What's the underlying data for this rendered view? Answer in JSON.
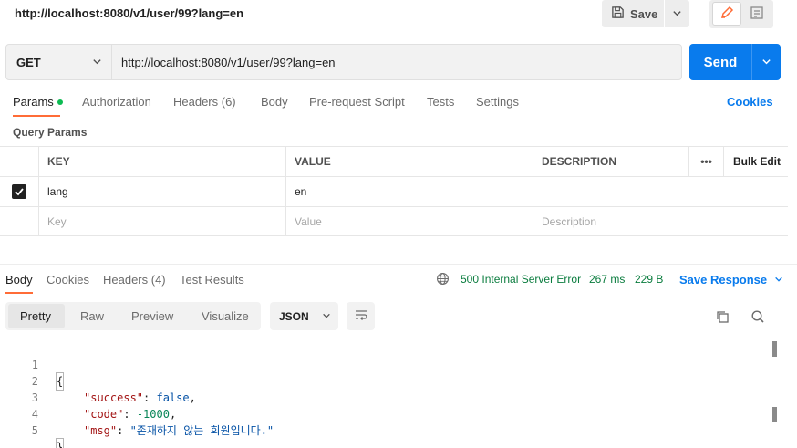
{
  "window": {
    "title": "http://localhost:8080/v1/user/99?lang=en"
  },
  "toolbar": {
    "save_label": "Save"
  },
  "request": {
    "method": "GET",
    "url": "http://localhost:8080/v1/user/99?lang=en",
    "send_label": "Send"
  },
  "request_tabs": [
    {
      "label": "Params",
      "active": true,
      "indicator": true
    },
    {
      "label": "Authorization"
    },
    {
      "label": "Headers (6)"
    },
    {
      "label": "Body"
    },
    {
      "label": "Pre-request Script"
    },
    {
      "label": "Tests"
    },
    {
      "label": "Settings"
    }
  ],
  "cookies_link": "Cookies",
  "query_params": {
    "section_label": "Query Params",
    "headers": {
      "key": "KEY",
      "value": "VALUE",
      "description": "DESCRIPTION",
      "more": "•••",
      "bulk_edit": "Bulk Edit"
    },
    "rows": [
      {
        "checked": true,
        "key": "lang",
        "value": "en",
        "description": ""
      }
    ],
    "placeholders": {
      "key": "Key",
      "value": "Value",
      "description": "Description"
    }
  },
  "response_tabs": [
    {
      "label": "Body",
      "active": true
    },
    {
      "label": "Cookies"
    },
    {
      "label": "Headers (4)"
    },
    {
      "label": "Test Results"
    }
  ],
  "response_status": {
    "status": "500 Internal Server Error",
    "time": "267 ms",
    "size": "229 B",
    "save_response_label": "Save Response"
  },
  "format_tabs": [
    {
      "label": "Pretty",
      "active": true
    },
    {
      "label": "Raw"
    },
    {
      "label": "Preview"
    },
    {
      "label": "Visualize"
    }
  ],
  "format_select": "JSON",
  "code_lines": [
    {
      "num": "1",
      "text": "{"
    },
    {
      "num": "2",
      "key": "\"success\"",
      "sep": ": ",
      "val": "false",
      "tail": ","
    },
    {
      "num": "3",
      "key": "\"code\"",
      "sep": ": ",
      "val": "-1000",
      "tail": ","
    },
    {
      "num": "4",
      "key": "\"msg\"",
      "sep": ": ",
      "val": "\"존재하지 않는 회원입니다.\"",
      "tail": ""
    },
    {
      "num": "5",
      "text": "}"
    }
  ],
  "colors": {
    "accent_orange": "#ff6c37",
    "primary_blue": "#097bed",
    "status_green": "#0a7c3e",
    "indicator_green": "#0cbb52"
  }
}
